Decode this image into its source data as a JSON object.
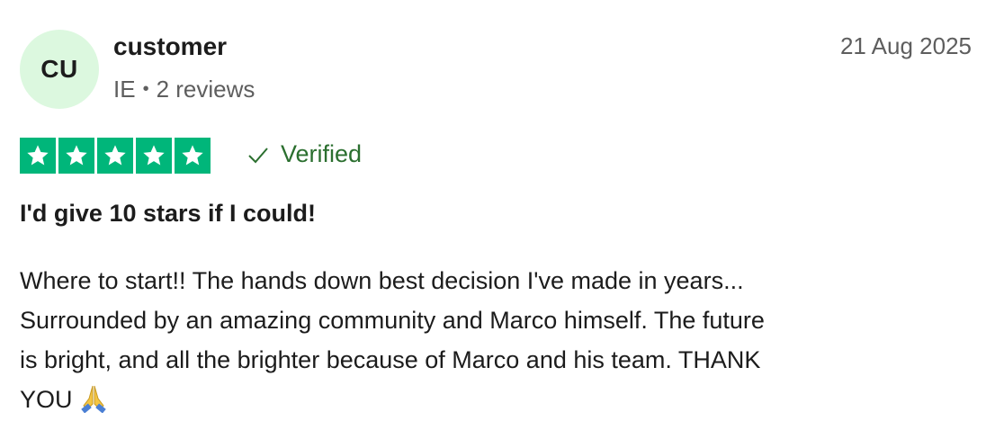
{
  "review": {
    "avatar_initials": "CU",
    "reviewer_name": "customer",
    "country": "IE",
    "review_count": "2 reviews",
    "date": "21 Aug 2025",
    "rating": 5,
    "rating_max": 5,
    "verified_label": "Verified",
    "title": "I'd give 10 stars if I could!",
    "body_lines": [
      "Where to start!! The hands down best decision I've made in years...",
      "Surrounded by an amazing community and Marco himself. The future",
      "is bright, and all the brighter because of Marco and his team. THANK",
      "YOU"
    ],
    "emoji": "folded-hands",
    "colors": {
      "star_green": "#00b67a",
      "avatar_bg": "#dcf8df",
      "verified_green": "#2b6f2f",
      "meta_gray": "#5e5e5e"
    }
  }
}
